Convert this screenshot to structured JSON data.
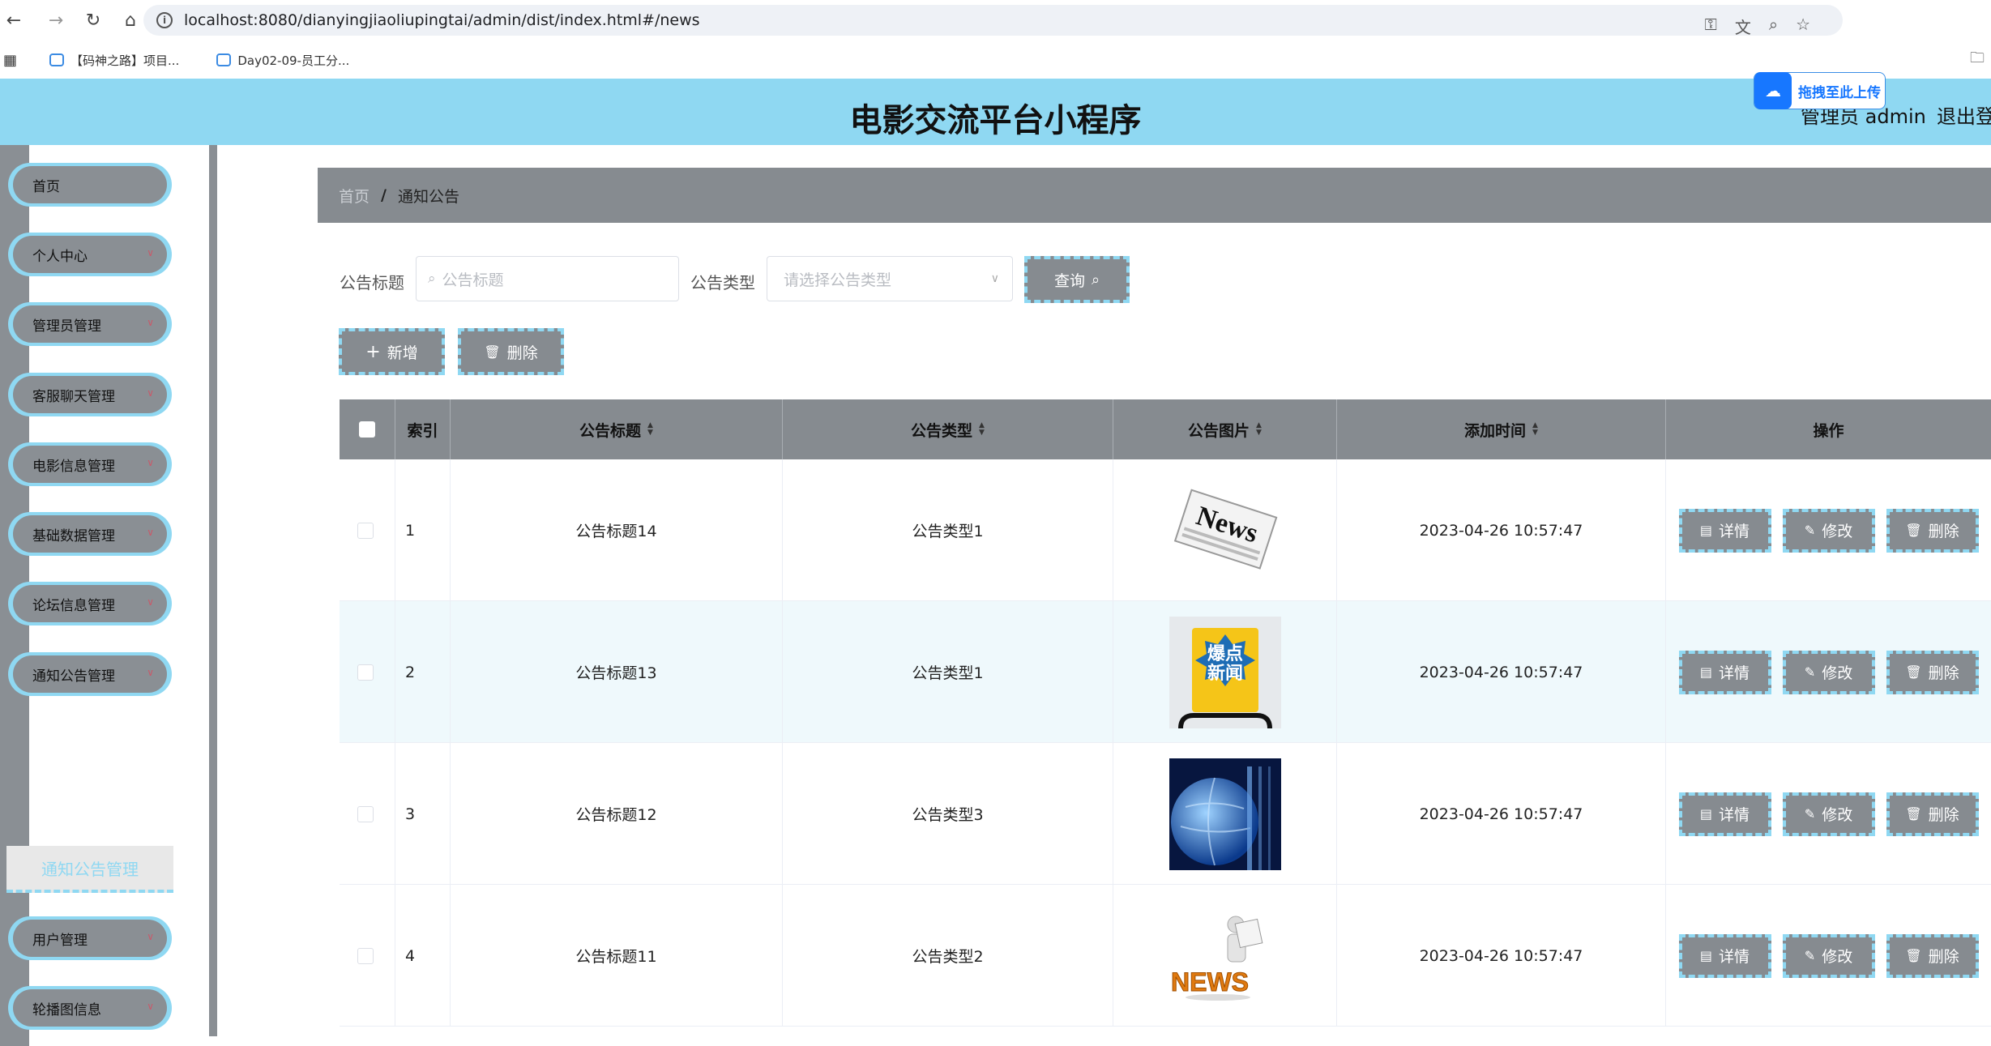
{
  "browser": {
    "url": "localhost:8080/dianyingjiaoliupingtai/admin/dist/index.html#/news",
    "bookmarks": [
      "【码神之路】项目...",
      "Day02-09-员工分..."
    ]
  },
  "header": {
    "title": "电影交流平台小程序",
    "admin_label": "管理员 admin",
    "logout_label": "退出登",
    "upload_popup": "拖拽至此上传"
  },
  "sidebar": {
    "items": [
      {
        "label": "首页"
      },
      {
        "label": "个人中心"
      },
      {
        "label": "管理员管理"
      },
      {
        "label": "客服聊天管理"
      },
      {
        "label": "电影信息管理"
      },
      {
        "label": "基础数据管理"
      },
      {
        "label": "论坛信息管理"
      },
      {
        "label": "通知公告管理"
      },
      {
        "label": "用户管理"
      },
      {
        "label": "轮播图信息"
      }
    ],
    "active_sub": "通知公告管理"
  },
  "breadcrumb": {
    "home": "首页",
    "sep": "/",
    "current": "通知公告"
  },
  "search": {
    "title_label": "公告标题",
    "title_placeholder": "公告标题",
    "type_label": "公告类型",
    "type_placeholder": "请选择公告类型",
    "query_button": "查询"
  },
  "actions": {
    "add": "新增",
    "delete": "删除"
  },
  "table": {
    "headers": [
      "索引",
      "公告标题",
      "公告类型",
      "公告图片",
      "添加时间",
      "操作"
    ],
    "rows": [
      {
        "index": "1",
        "title": "公告标题14",
        "type": "公告类型1",
        "image": "news-newspaper",
        "time": "2023-04-26 10:57:47"
      },
      {
        "index": "2",
        "title": "公告标题13",
        "type": "公告类型1",
        "image": "hot-news-badge",
        "time": "2023-04-26 10:57:47"
      },
      {
        "index": "3",
        "title": "公告标题12",
        "type": "公告类型3",
        "image": "globe-broadcast",
        "time": "2023-04-26 10:57:47"
      },
      {
        "index": "4",
        "title": "公告标题11",
        "type": "公告类型2",
        "image": "news-figure",
        "time": "2023-04-26 10:57:47"
      }
    ],
    "row_actions": {
      "detail": "详情",
      "edit": "修改",
      "delete": "删除"
    },
    "thumb_text": {
      "row1": "News",
      "row2a": "爆点",
      "row2b": "新闻",
      "row4": "NEWS"
    }
  },
  "colors": {
    "accent": "#8fd8f2",
    "gray": "#868b90",
    "row_alt": "#eff9fc"
  }
}
